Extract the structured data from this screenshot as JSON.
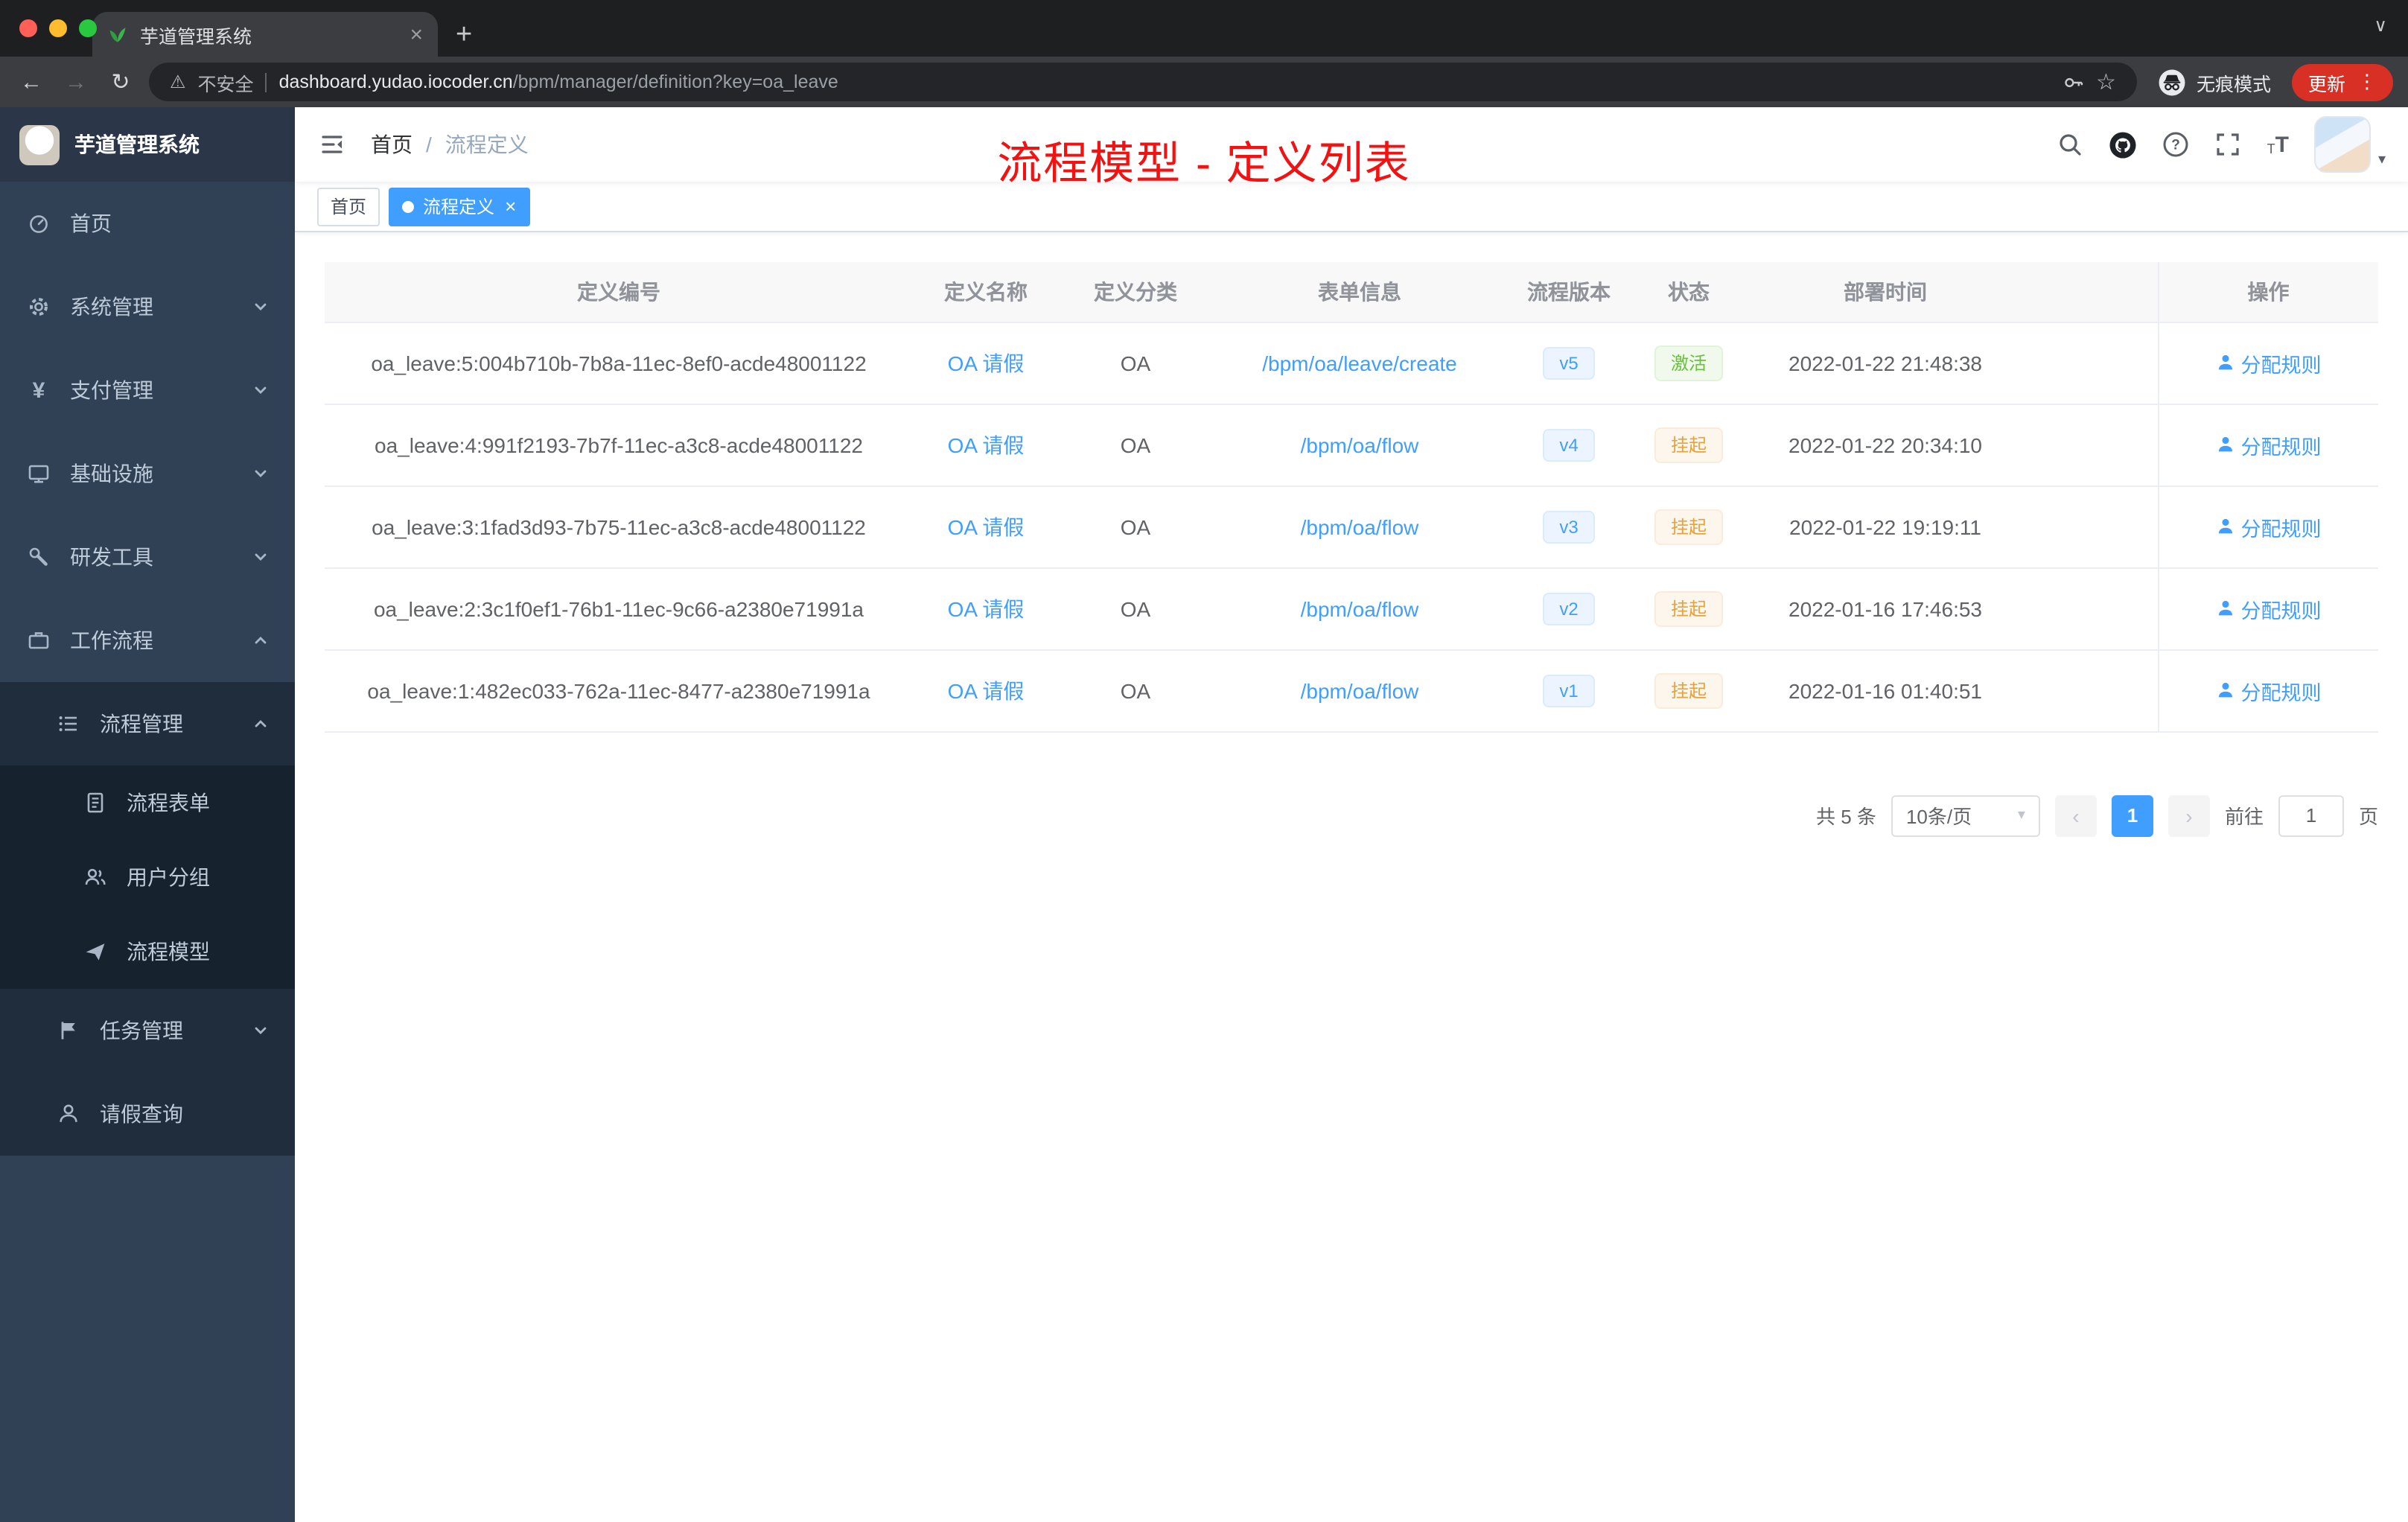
{
  "browser": {
    "tab": {
      "title": "芋道管理系统"
    },
    "address": {
      "security": "不安全",
      "host": "dashboard.yudao.iocoder.cn",
      "path": "/bpm/manager/definition?key=oa_leave"
    },
    "incognito_label": "无痕模式",
    "update_label": "更新"
  },
  "sidebar": {
    "logo_title": "芋道管理系统",
    "menu": {
      "home": "首页",
      "system": "系统管理",
      "payment": "支付管理",
      "infra": "基础设施",
      "devtools": "研发工具",
      "workflow": "工作流程",
      "process_manage": "流程管理",
      "process_form": "流程表单",
      "user_group": "用户分组",
      "process_model": "流程模型",
      "task_manage": "任务管理",
      "leave_query": "请假查询"
    }
  },
  "header": {
    "breadcrumb": {
      "home": "首页",
      "separator": "/",
      "current": "流程定义"
    },
    "annotation": "流程模型 - 定义列表"
  },
  "tags": {
    "home": "首页",
    "active": "流程定义"
  },
  "table": {
    "columns": [
      "定义编号",
      "定义名称",
      "定义分类",
      "表单信息",
      "流程版本",
      "状态",
      "部署时间",
      "操作"
    ],
    "action_label": "分配规则",
    "rows": [
      {
        "id": "oa_leave:5:004b710b-7b8a-11ec-8ef0-acde48001122",
        "name": "OA 请假",
        "category": "OA",
        "form": "/bpm/oa/leave/create",
        "version": "v5",
        "status": "激活",
        "status_type": "success",
        "deploy_time": "2022-01-22 21:48:38"
      },
      {
        "id": "oa_leave:4:991f2193-7b7f-11ec-a3c8-acde48001122",
        "name": "OA 请假",
        "category": "OA",
        "form": "/bpm/oa/flow",
        "version": "v4",
        "status": "挂起",
        "status_type": "warning",
        "deploy_time": "2022-01-22 20:34:10"
      },
      {
        "id": "oa_leave:3:1fad3d93-7b75-11ec-a3c8-acde48001122",
        "name": "OA 请假",
        "category": "OA",
        "form": "/bpm/oa/flow",
        "version": "v3",
        "status": "挂起",
        "status_type": "warning",
        "deploy_time": "2022-01-22 19:19:11"
      },
      {
        "id": "oa_leave:2:3c1f0ef1-76b1-11ec-9c66-a2380e71991a",
        "name": "OA 请假",
        "category": "OA",
        "form": "/bpm/oa/flow",
        "version": "v2",
        "status": "挂起",
        "status_type": "warning",
        "deploy_time": "2022-01-16 17:46:53"
      },
      {
        "id": "oa_leave:1:482ec033-762a-11ec-8477-a2380e71991a",
        "name": "OA 请假",
        "category": "OA",
        "form": "/bpm/oa/flow",
        "version": "v1",
        "status": "挂起",
        "status_type": "warning",
        "deploy_time": "2022-01-16 01:40:51"
      }
    ]
  },
  "pagination": {
    "total_label": "共 5 条",
    "page_size": "10条/页",
    "prev": "‹",
    "current_page": "1",
    "next": "›",
    "goto_label": "前往",
    "goto_value": "1",
    "goto_suffix": "页"
  }
}
